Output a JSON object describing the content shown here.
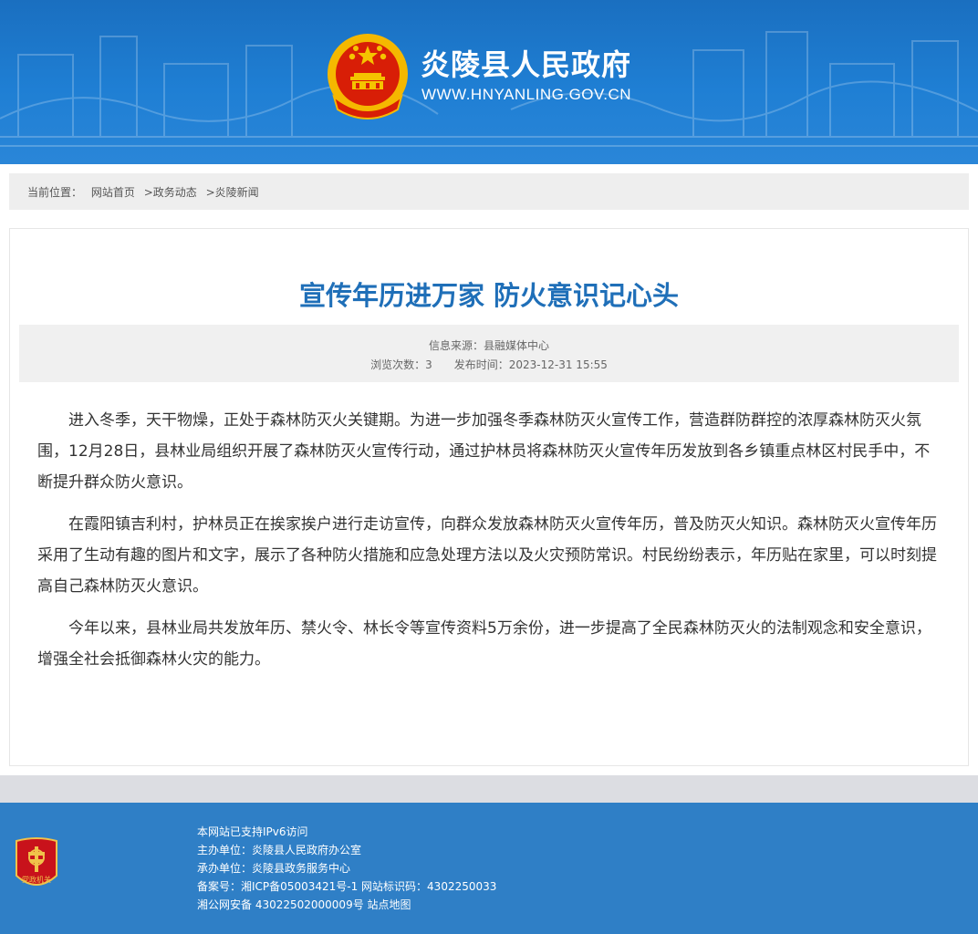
{
  "header": {
    "site_title": "炎陵县人民政府",
    "site_url": "WWW.HNYANLING.GOV.CN",
    "emblem_icon": "national-emblem-icon",
    "bg_color": "#1f7fd4"
  },
  "breadcrumb": {
    "label": "当前位置：",
    "items": [
      "网站首页",
      ">政务动态",
      ">炎陵新闻"
    ]
  },
  "article": {
    "title": "宣传年历进万家 防火意识记心头",
    "title_color": "#1f6fb8",
    "source": "信息来源：县融媒体中心",
    "views": "浏览次数：3",
    "published": "发布时间：2023-12-31 15:55",
    "paragraphs": [
      "进入冬季，天干物燥，正处于森林防灭火关键期。为进一步加强冬季森林防灭火宣传工作，营造群防群控的浓厚森林防灭火氛围，12月28日，县林业局组织开展了森林防灭火宣传行动，通过护林员将森林防灭火宣传年历发放到各乡镇重点林区村民手中，不断提升群众防火意识。",
      "在霞阳镇吉利村，护林员正在挨家挨户进行走访宣传，向群众发放森林防灭火宣传年历，普及防灭火知识。森林防灭火宣传年历采用了生动有趣的图片和文字，展示了各种防火措施和应急处理方法以及火灾预防常识。村民纷纷表示，年历贴在家里，可以时刻提高自己森林防灭火意识。",
      "今年以来，县林业局共发放年历、禁火令、林长令等宣传资料5万余份，进一步提高了全民森林防灭火的法制观念和安全意识，增强全社会抵御森林火灾的能力。"
    ]
  },
  "footer": {
    "badge_icon": "party-government-badge-icon",
    "badge_text": "党政机关",
    "ipv6": "本网站已支持IPv6访问",
    "sponsor": "主办单位：炎陵县人民政府办公室",
    "organizer": "承办单位：炎陵县政务服务中心",
    "icp_label": "备案号：",
    "icp_number": "湘ICP备05003421号-1",
    "site_code": "网站标识码：4302250033",
    "police_record": "湘公网安备 43022502000009号",
    "sitemap": "站点地图",
    "bg_color": "#2f7fc6"
  }
}
